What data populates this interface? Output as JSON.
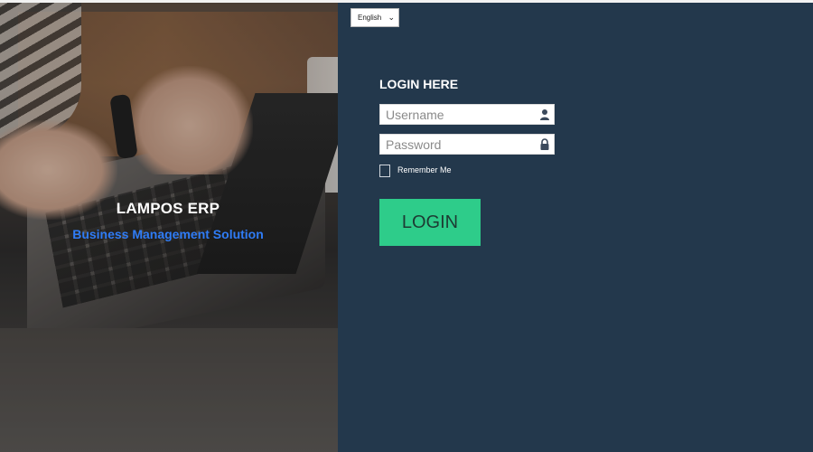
{
  "brand": {
    "title": "LAMPOS ERP",
    "subtitle": "Business Management Solution"
  },
  "language_select": {
    "selected": "English"
  },
  "login_form": {
    "heading": "LOGIN HERE",
    "username_placeholder": "Username",
    "password_placeholder": "Password",
    "remember_label": "Remember Me",
    "button_label": "LOGIN"
  },
  "icons": {
    "username": "user-icon",
    "password": "lock-icon",
    "language_dropdown": "chevron-down-icon"
  },
  "colors": {
    "panel_background": "#23384c",
    "login_button": "#2ecc8a",
    "subtitle": "#2f7cf6"
  }
}
